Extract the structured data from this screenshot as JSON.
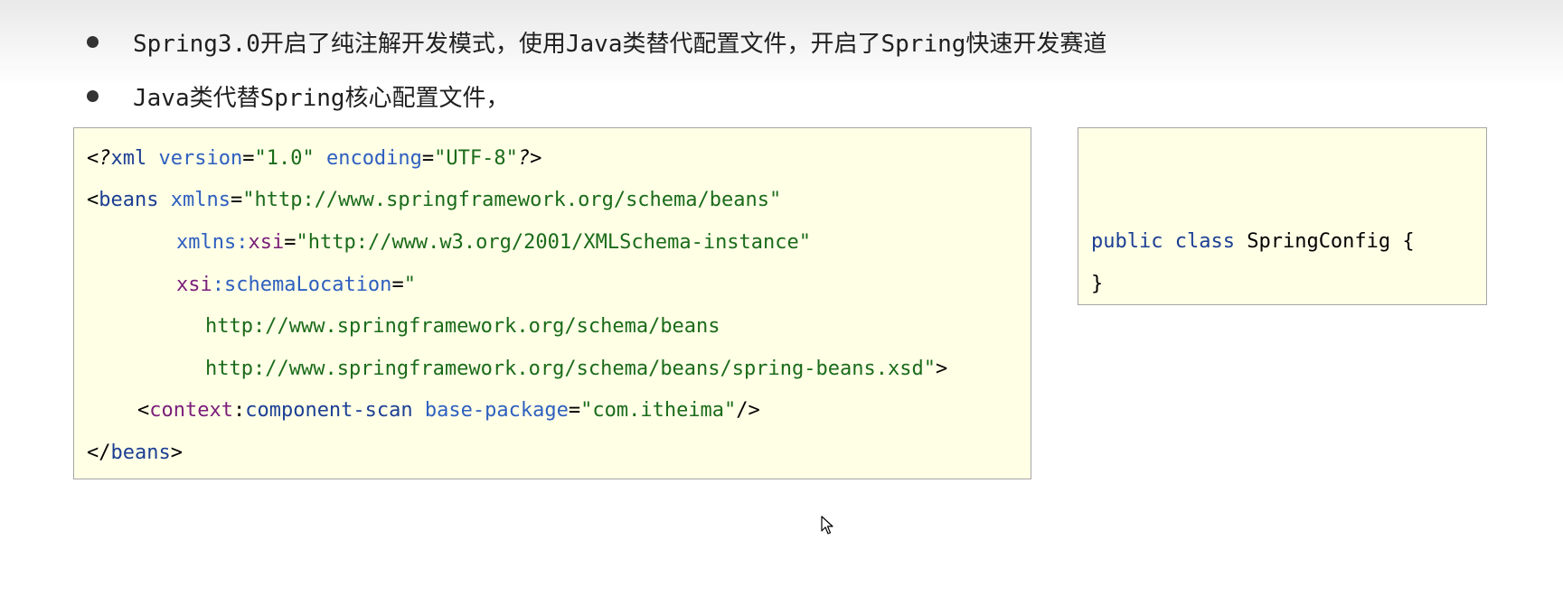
{
  "bullets": [
    "Spring3.0开启了纯注解开发模式，使用Java类替代配置文件，开启了Spring快速开发赛道",
    "Java类代替Spring核心配置文件，"
  ],
  "xml_code": {
    "line1": {
      "open": "<",
      "pi_q": "?",
      "tag": "xml",
      "sp1": " ",
      "attr1": "version",
      "eq1": "=",
      "val1": "\"1.0\"",
      "sp2": " ",
      "attr2": "encoding",
      "eq2": "=",
      "val2": "\"UTF-8\"",
      "close": "?>"
    },
    "line2": {
      "open": "<",
      "tag": "beans",
      "sp": " ",
      "attr": "xmlns",
      "eq": "=",
      "val": "\"http://www.springframework.org/schema/beans\""
    },
    "line3": {
      "attr": "xmlns:",
      "ns": "xsi",
      "eq": "=",
      "val": "\"http://www.w3.org/2001/XMLSchema-instance\""
    },
    "line4": {
      "ns": "xsi",
      "attr": ":schemaLocation",
      "eq": "=",
      "val": "\""
    },
    "line5": {
      "val": "http://www.springframework.org/schema/beans"
    },
    "line6": {
      "val": "http://www.springframework.org/schema/beans/spring-beans.xsd\"",
      "close": ">"
    },
    "line7": {
      "open": "<",
      "ns": "context",
      "colon": ":",
      "tag": "component-scan",
      "sp": " ",
      "attr": "base-package",
      "eq": "=",
      "val": "\"com.itheima\"",
      "close": "/>"
    },
    "line8": {
      "open": "</",
      "tag": "beans",
      "close": ">"
    }
  },
  "java_code": {
    "kw1": "public",
    "kw2": "class",
    "class_name": "SpringConfig",
    "brace_open": "{",
    "brace_close": "}"
  }
}
